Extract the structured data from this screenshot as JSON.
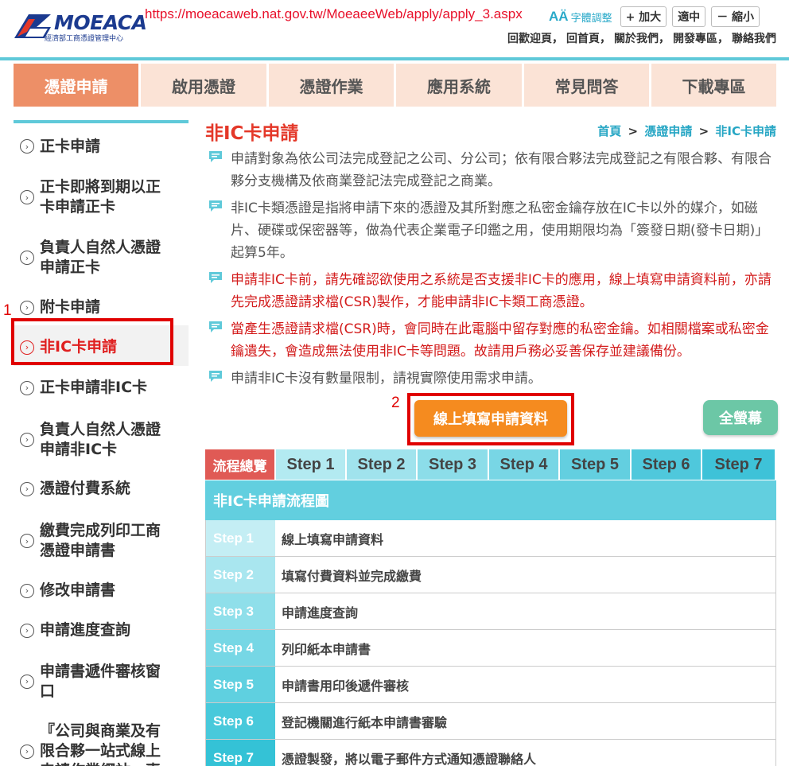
{
  "header": {
    "logo_text": "MOEACA",
    "logo_sub": "經濟部工商憑證管理中心",
    "url_overlay": "https://moeacaweb.nat.gov.tw/MoeaeeWeb/apply/apply_3.aspx",
    "font_ctrl_icon": "AÄ",
    "font_ctrl_label": "字體調整",
    "font_buttons": [
      "+ 加大",
      "適中",
      "－ 縮小"
    ],
    "top_links": [
      "回歡迎頁，",
      "回首頁，",
      "關於我們，",
      "開發專區，",
      "聯絡我們"
    ]
  },
  "mainnav": {
    "tabs": [
      {
        "label": "憑證申請",
        "active": true
      },
      {
        "label": "啟用憑證",
        "active": false
      },
      {
        "label": "憑證作業",
        "active": false
      },
      {
        "label": "應用系統",
        "active": false
      },
      {
        "label": "常見問答",
        "active": false
      },
      {
        "label": "下載專區",
        "active": false
      }
    ]
  },
  "sidebar": {
    "bullet": "›",
    "items": [
      {
        "lines": [
          "正卡申請"
        ],
        "active": false
      },
      {
        "lines": [
          "正卡即將到期以正",
          "卡申請正卡"
        ],
        "active": false
      },
      {
        "lines": [
          "負責人自然人憑證",
          "申請正卡"
        ],
        "active": false
      },
      {
        "lines": [
          "附卡申請"
        ],
        "active": false
      },
      {
        "lines": [
          "非IC卡申請"
        ],
        "active": true
      },
      {
        "lines": [
          "正卡申請非IC卡"
        ],
        "active": false
      },
      {
        "lines": [
          "負責人自然人憑證",
          "申請非IC卡"
        ],
        "active": false
      },
      {
        "lines": [
          "憑證付費系統"
        ],
        "active": false
      },
      {
        "lines": [
          "繳費完成列印工商",
          "憑證申請書"
        ],
        "active": false
      },
      {
        "lines": [
          "修改申請書"
        ],
        "active": false
      },
      {
        "lines": [
          "申請進度查詢"
        ],
        "active": false
      },
      {
        "lines": [
          "申請書遞件審核窗",
          "口"
        ],
        "active": false
      },
      {
        "lines": [
          "『公司與商業及有",
          "限合夥一站式線上",
          "申請作業網站』專"
        ],
        "active": false
      }
    ]
  },
  "annotations": {
    "marker_1": "1",
    "marker_2": "2"
  },
  "content": {
    "title": "非IC卡申請",
    "breadcrumb": [
      "首頁",
      "憑證申請",
      "非IC卡申請"
    ],
    "breadcrumb_sep": ">",
    "notes": [
      {
        "text": "申請對象為依公司法完成登記之公司、分公司；依有限合夥法完成登記之有限合夥、有限合夥分支機構及依商業登記法完成登記之商業。",
        "red": false
      },
      {
        "text": "非IC卡類憑證是指將申請下來的憑證及其所對應之私密金鑰存放在IC卡以外的媒介，如磁片、硬碟或保密器等，做為代表企業電子印鑑之用，使用期限均為「簽發日期(發卡日期)」起算5年。",
        "red": false
      },
      {
        "text": "申請非IC卡前，請先確認欲使用之系統是否支援非IC卡的應用，線上填寫申請資料前，亦請先完成憑證請求檔(CSR)製作，才能申請非IC卡類工商憑證。",
        "red": true
      },
      {
        "text": "當產生憑證請求檔(CSR)時，會同時在此電腦中留存對應的私密金鑰。如相關檔案或私密金鑰遺失，會造成無法使用非IC卡等問題。故請用戶務必妥善保存並建議備份。",
        "red": true
      },
      {
        "text": "申請非IC卡沒有數量限制，請視實際使用需求申請。",
        "red": false
      }
    ],
    "apply_button": "線上填寫申請資料",
    "fullscreen_button": "全螢幕"
  },
  "steps": {
    "tabs": [
      {
        "label": "流程總覽",
        "color": "#e05a55",
        "overview": true
      },
      {
        "label": "Step 1",
        "color": "#b3eaf1"
      },
      {
        "label": "Step 2",
        "color": "#a0e3ed"
      },
      {
        "label": "Step 3",
        "color": "#8cdde9"
      },
      {
        "label": "Step 4",
        "color": "#78d6e5"
      },
      {
        "label": "Step 5",
        "color": "#63cfe0"
      },
      {
        "label": "Step 6",
        "color": "#4fc8dc"
      },
      {
        "label": "Step 7",
        "color": "#3ec2d8"
      }
    ],
    "flow_title": "非IC卡申請流程圖",
    "rows": [
      {
        "step": "Step 1",
        "desc": "線上填寫申請資料",
        "color": "#c4eef4"
      },
      {
        "step": "Step 2",
        "desc": "填寫付費資料並完成繳費",
        "color": "#a9e6ef"
      },
      {
        "step": "Step 3",
        "desc": "申請進度查詢",
        "color": "#8fdfea"
      },
      {
        "step": "Step 4",
        "desc": "列印紙本申請書",
        "color": "#76d7e5"
      },
      {
        "step": "Step 5",
        "desc": "申請書用印後遞件審核",
        "color": "#5fd0e0"
      },
      {
        "step": "Step 6",
        "desc": "登記機關進行紙本申請書審驗",
        "color": "#48c9db"
      },
      {
        "step": "Step 7",
        "desc": "憑證製發，將以電子郵件方式通知憑證聯絡人",
        "color": "#34c2d6"
      }
    ]
  }
}
